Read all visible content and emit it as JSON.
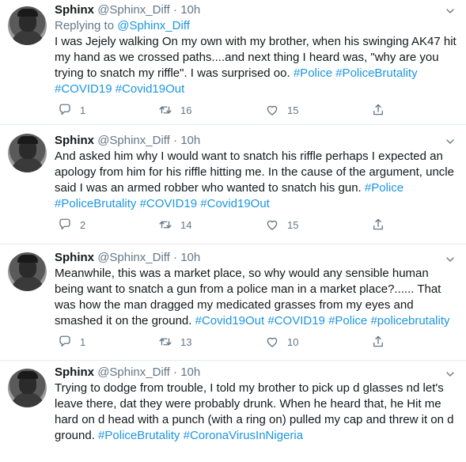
{
  "tweets": [
    {
      "name": "Sphinx",
      "handle": "@Sphinx_Diff",
      "sep": "·",
      "time": "10h",
      "replying_prefix": "Replying to",
      "replying_handle": "@Sphinx_Diff",
      "text_plain": "I was Jejely walking On my own with my brother,  when his swinging AK47 hit my hand as we crossed paths....and next thing I heard was,  \"why are you trying to snatch my riffle\".  I was surprised oo.",
      "hashtags": [
        "#Police",
        "#PoliceBrutality",
        "#COVID19",
        "#Covid19Out"
      ],
      "replies": "1",
      "retweets": "16",
      "likes": "15"
    },
    {
      "name": "Sphinx",
      "handle": "@Sphinx_Diff",
      "sep": "·",
      "time": "10h",
      "text_plain": "And asked him why I would want to snatch his riffle perhaps I expected an apology from him for his riffle hitting me. In the cause of the argument, uncle said I was an armed robber who wanted to snatch his gun.",
      "hashtags": [
        "#Police",
        "#PoliceBrutality",
        "#COVID19",
        "#Covid19Out"
      ],
      "replies": "2",
      "retweets": "14",
      "likes": "15"
    },
    {
      "name": "Sphinx",
      "handle": "@Sphinx_Diff",
      "sep": "·",
      "time": "10h",
      "text_plain": "Meanwhile, this was a market place,  so why would any sensible human being want to snatch a gun from a police man in a market place?...... That was how the man dragged my medicated grasses from my eyes and smashed it on the ground.",
      "hashtags": [
        "#Covid19Out",
        "#COVID19",
        "#Police",
        "#policebrutality"
      ],
      "replies": "1",
      "retweets": "13",
      "likes": "10"
    },
    {
      "name": "Sphinx",
      "handle": "@Sphinx_Diff",
      "sep": "·",
      "time": "10h",
      "text_plain": "Trying to dodge from trouble,  I told my brother to pick up d glasses nd let's leave there,  dat they were probably drunk.  When he heard that, he Hit me hard on d head with a punch (with a ring on) pulled my cap and threw it on d ground.",
      "hashtags": [
        "#PoliceBrutality",
        "#CoronaVirusInNigeria"
      ]
    }
  ]
}
